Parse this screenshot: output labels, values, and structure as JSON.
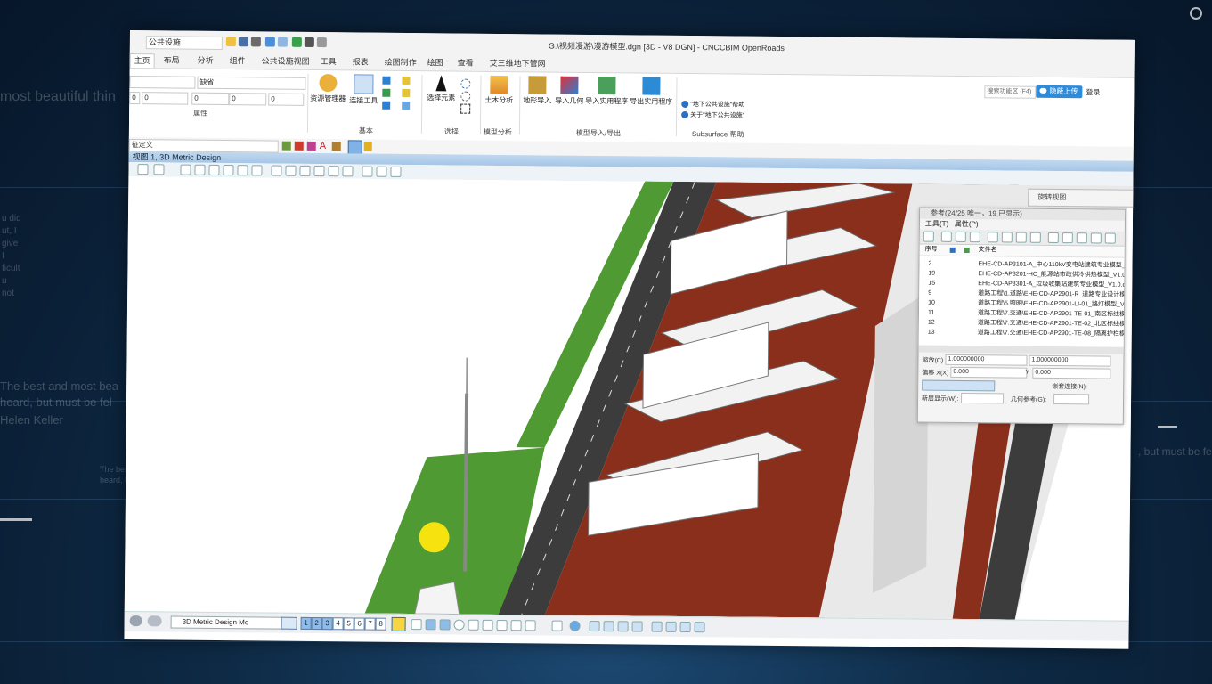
{
  "background": {
    "texts": [
      "most beautiful thin",
      "u did",
      "ut, I",
      "give",
      "I",
      "ficult",
      "u",
      "not",
      "The best and most bea",
      "heard, but must be fel",
      "Helen Keller",
      ", but must be fel",
      "The best",
      "heard, b"
    ]
  },
  "quick_access": {
    "workflow_combo": "公共设施",
    "window_title": "G:\\视频漫游\\漫游模型.dgn [3D - V8 DGN] - CNCCBIM OpenRoads"
  },
  "tabs": [
    "主页",
    "布局",
    "分析",
    "组件",
    "公共设施视图",
    "工具",
    "报表",
    "绘图制作",
    "绘图",
    "查看",
    "艾三维地下管网"
  ],
  "ribbon": {
    "level_combo": "缺省",
    "num_fields": [
      "0",
      "0",
      "0",
      "0",
      "0"
    ],
    "attributes_label": "属性",
    "attr_combo": "征定义",
    "basic_label": "基本",
    "resource_manager": "资源管理器",
    "connect_tools": "连接工具",
    "select_element": "选择元素",
    "select_label": "选择",
    "civil_analysis": "土木分析",
    "model_analysis_label": "模型分析",
    "terrain_import": "地形导入",
    "import_geometry": "导入几何",
    "import_utility": "导入实用程序",
    "export_utility": "导出实用程序",
    "model_io_label": "模型导入/导出",
    "help_1": "\"地下公共设施\"帮助",
    "help_2": "关于\"地下公共设施\"",
    "help_group_label": "Subsurface 帮助",
    "search_placeholder": "搜索功能区 (F4)",
    "cloud_button": "隐蔽上传",
    "login": "登录"
  },
  "view": {
    "title": "视图 1, 3D Metric Design"
  },
  "rotate_view": {
    "title": "旋转视图"
  },
  "reference_panel": {
    "title": "参考(24/25 唯一，19 已显示)",
    "menu": [
      "工具(T)",
      "属性(P)"
    ],
    "columns": {
      "seq": "序号",
      "file": "文件名"
    },
    "rows": [
      {
        "n": "2",
        "f": "EHE-CD-AP3101-A_中心110kV变电站建筑专业模型_V"
      },
      {
        "n": "19",
        "f": "EHE-CD-AP3201-HC_能源站市政供冷供热模型_V1.0.d"
      },
      {
        "n": "15",
        "f": "EHE-CD-AP3301-A_垃圾收集站建筑专业模型_V1.0.dg"
      },
      {
        "n": "9",
        "f": "道路工程\\1.道路\\EHE-CD-AP2901-R_道路专业设计模型"
      },
      {
        "n": "10",
        "f": "道路工程\\5.照明\\EHE-CD-AP2901-LI-01_路灯模型_V1"
      },
      {
        "n": "11",
        "f": "道路工程\\7.交通\\EHE-CD-AP2901-TE-01_南区标线模型"
      },
      {
        "n": "12",
        "f": "道路工程\\7.交通\\EHE-CD-AP2901-TE-02_北区标线模型"
      },
      {
        "n": "13",
        "f": "道路工程\\7.交通\\EHE-CD-AP2901-TE-08_隔离护栏模型"
      }
    ],
    "scale_label": "缩放(C)",
    "scale_1": "1.000000000",
    "scale_2": "1.000000000",
    "offset_label": "偏移 X(X)",
    "offset_x": "0.000",
    "y_label": "Y",
    "offset_y": "0.000",
    "nesting_label": "嵌套连接(N):",
    "new_level_display": "新层显示(W):",
    "geo_ref": "几何参考(G):"
  },
  "bottom_bar": {
    "model_combo": "3D Metric Design Mo",
    "view_buttons": [
      "1",
      "2",
      "3",
      "4",
      "5",
      "6",
      "7",
      "8"
    ]
  },
  "colors": {
    "grass": "#4f9a32",
    "road": "#3c3c3c",
    "brick": "#8a2f1c",
    "accent": "#2f8ad8",
    "cursor": "#f6e20e"
  }
}
